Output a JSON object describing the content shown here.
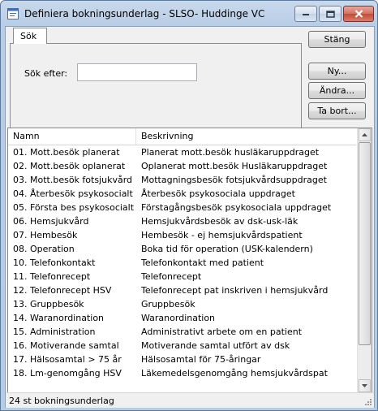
{
  "window": {
    "title": "Definiera bokningsunderlag - SLSO- Huddinge VC",
    "icon": "app-window-icon"
  },
  "search_tab": {
    "label": "Sök",
    "field_label": "Sök efter:",
    "field_value": "",
    "field_placeholder": ""
  },
  "buttons": {
    "close": "Stäng",
    "new": "Ny...",
    "edit": "Ändra...",
    "delete": "Ta bort..."
  },
  "list": {
    "columns": [
      "Namn",
      "Beskrivning"
    ],
    "rows": [
      {
        "name": "01. Mott.besök planerat",
        "desc": "Planerat mott.besök husläkaruppdraget"
      },
      {
        "name": "02. Mott.besök oplanerat",
        "desc": "Oplanerat mott.besök Husläkaruppdraget"
      },
      {
        "name": "03. Mott.besök fotsjukvård",
        "desc": "Mottagningsbesök fotsjukvårdsuppdraget"
      },
      {
        "name": "04. Återbesök psykosocialt",
        "desc": "Återbesök psykosociala uppdraget"
      },
      {
        "name": "05. Första bes psykosocialt",
        "desc": "Förstagångsbesök psykosociala uppdraget"
      },
      {
        "name": "06. Hemsjukvård",
        "desc": "Hemsjukvårdsbesök av dsk-usk-läk"
      },
      {
        "name": "07. Hembesök",
        "desc": "Hembesök - ej hemsjukvårdspatient"
      },
      {
        "name": "08. Operation",
        "desc": "Boka tid för operation (USK-kalendern)"
      },
      {
        "name": "10. Telefonkontakt",
        "desc": "Telefonkontakt med patient"
      },
      {
        "name": "11. Telefonrecept",
        "desc": "Telefonrecept"
      },
      {
        "name": "12. Telefonrecept HSV",
        "desc": "Telefonrecept pat inskriven i hemsjukvård"
      },
      {
        "name": "13. Gruppbesök",
        "desc": "Gruppbesök"
      },
      {
        "name": "14. Waranordination",
        "desc": "Waranordination"
      },
      {
        "name": "15. Administration",
        "desc": "Administrativt arbete om en patient"
      },
      {
        "name": "16. Motiverande samtal",
        "desc": "Motiverande samtal utfört av dsk"
      },
      {
        "name": "17. Hälsosamtal > 75 år",
        "desc": "Hälsosamtal för 75-åringar"
      },
      {
        "name": "18. Lm-genomgång HSV",
        "desc": "Läkemedelsgenomgång hemsjukvårdspat"
      }
    ]
  },
  "status": {
    "text": "24 st bokningsunderlag"
  }
}
